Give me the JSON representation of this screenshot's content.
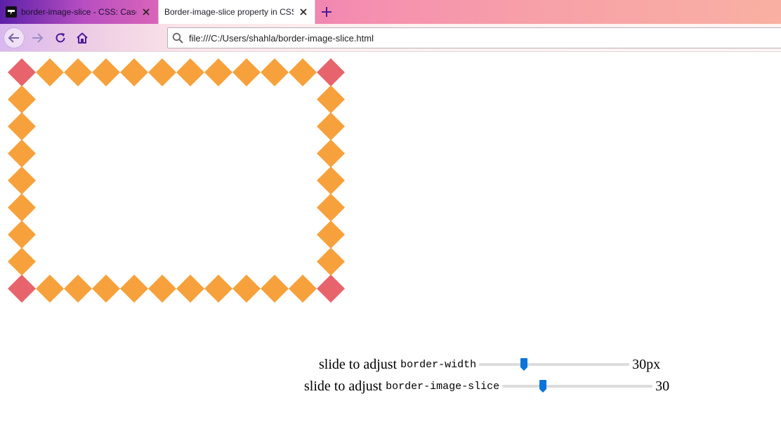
{
  "browser": {
    "tabs": [
      {
        "title": "border-image-slice - CSS: Casc",
        "active": false
      },
      {
        "title": "Border-image-slice property in CSS",
        "active": true
      }
    ],
    "url": "file:///C:/Users/shahla/border-image-slice.html"
  },
  "colors": {
    "diamond": "#f7a13c",
    "corner_diamond": "#e8646c",
    "accent": "#0a74da"
  },
  "border_demo": {
    "columns": 12,
    "rows": 9,
    "corner_color": "#e8646c",
    "edge_color": "#f7a13c"
  },
  "controls": {
    "width": {
      "label": "slide to adjust",
      "code": "border-width",
      "value_text": "30px",
      "slider_fraction": 0.3
    },
    "slice": {
      "label": "slide to adjust",
      "code": "border-image-slice",
      "value_text": "30",
      "slider_fraction": 0.27
    }
  }
}
